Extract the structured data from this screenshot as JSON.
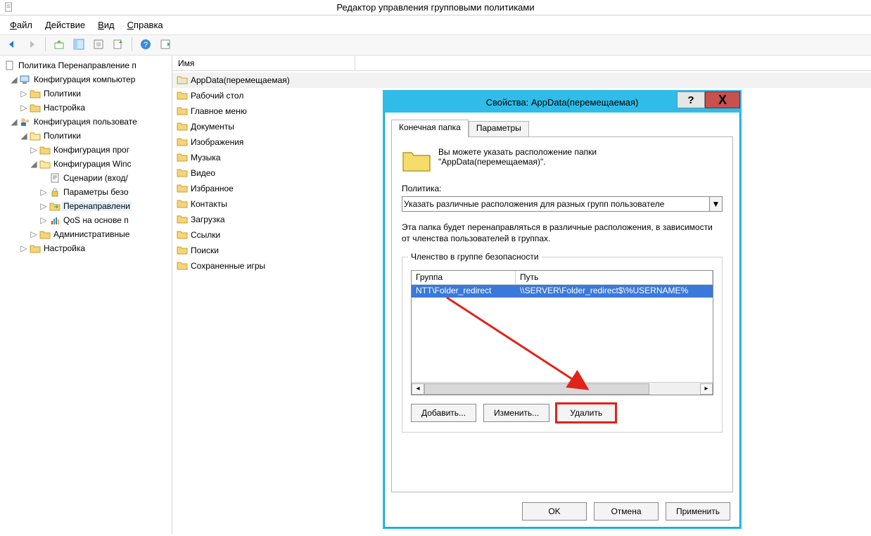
{
  "window": {
    "title": "Редактор управления групповыми политиками"
  },
  "menu": {
    "file": "Файл",
    "action": "Действие",
    "view": "Вид",
    "help": "Справка"
  },
  "tree": {
    "root": "Политика Перенаправление п",
    "compConfig": "Конфигурация компьютер",
    "compPolicies": "Политики",
    "compPrefs": "Настройка",
    "userConfig": "Конфигурация пользовате",
    "userPolicies": "Политики",
    "softwareCfg": "Конфигурация прог",
    "windowsCfg": "Конфигурация Winc",
    "scripts": "Сценарии (вход/",
    "secParams": "Параметры безо",
    "folderRedirect": "Перенаправлени",
    "qos": "QoS на основе п",
    "adminTemplates": "Административные",
    "userPrefs": "Настройка"
  },
  "list": {
    "header": "Имя",
    "items": [
      "AppData(перемещаемая)",
      "Рабочий стол",
      "Главное меню",
      "Документы",
      "Изображения",
      "Музыка",
      "Видео",
      "Избранное",
      "Контакты",
      "Загрузка",
      "Ссылки",
      "Поиски",
      "Сохраненные игры"
    ]
  },
  "dialog": {
    "title": "Свойства: AppData(перемещаемая)",
    "help": "?",
    "close": "X",
    "tabs": {
      "target": "Конечная папка",
      "params": "Параметры"
    },
    "info1": "Вы можете указать расположение папки",
    "info2": "\"AppData(перемещаемая)\".",
    "policyLabel": "Политика:",
    "policyValue": "Указать различные расположения для разных групп пользователе",
    "desc": "Эта папка будет перенаправляться в различные расположения, в зависимости от членства пользователей в группах.",
    "groupTitle": "Членство в группе безопасности",
    "gridCols": {
      "group": "Группа",
      "path": "Путь"
    },
    "gridRow": {
      "group": "NTT\\Folder_redirect",
      "path": "\\\\SERVER\\Folder_redirect$\\%USERNAME%"
    },
    "buttons": {
      "add": "Добавить...",
      "edit": "Изменить...",
      "delete": "Удалить"
    },
    "ok": "OK",
    "cancel": "Отмена",
    "apply": "Применить"
  }
}
